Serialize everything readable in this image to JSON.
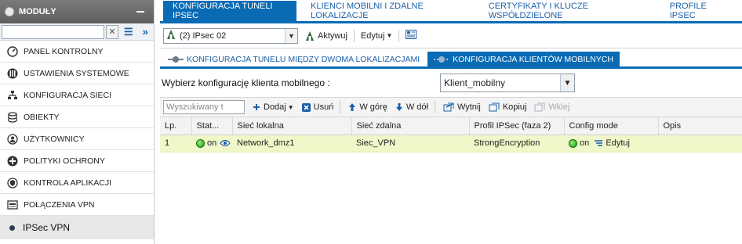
{
  "sidebar": {
    "title": "MODUŁY",
    "search_placeholder": "",
    "items": [
      {
        "label": "PANEL KONTROLNY",
        "icon": "gauge-icon"
      },
      {
        "label": "USTAWIENIA SYSTEMOWE",
        "icon": "sliders-icon"
      },
      {
        "label": "KONFIGURACJA SIECI",
        "icon": "network-icon"
      },
      {
        "label": "OBIEKTY",
        "icon": "database-icon"
      },
      {
        "label": "UŻYTKOWNICY",
        "icon": "user-icon"
      },
      {
        "label": "POLITYKI OCHRONY",
        "icon": "policy-icon"
      },
      {
        "label": "KONTROLA APLIKACJI",
        "icon": "shield-icon"
      },
      {
        "label": "POŁĄCZENIA VPN",
        "icon": "vpn-icon"
      }
    ],
    "active_sub": "IPSec VPN"
  },
  "tabs": [
    {
      "label": "KONFIGURACJA TUNELI IPSEC",
      "active": true
    },
    {
      "label": "KLIENCI MOBILNI I ZDALNE LOKALIZACJE",
      "active": false
    },
    {
      "label": "CERTYFIKATY I KLUCZE WSPÓŁDZIELONE",
      "active": false
    },
    {
      "label": "PROFILE IPSEC",
      "active": false
    }
  ],
  "toolbar1": {
    "policy_value": "(2) IPsec 02",
    "activate_label": "Aktywuj",
    "edit_label": "Edytuj"
  },
  "subtabs": [
    {
      "label": "KONFIGURACJA TUNELU MIĘDZY DWOMA LOKALIZACJAMI",
      "active": false
    },
    {
      "label": "KONFIGURACJA KLIENTÓW MOBILNYCH",
      "active": true
    }
  ],
  "mobile_select": {
    "label": "Wybierz konfigurację klienta mobilnego :",
    "value": "Klient_mobilny"
  },
  "toolbar2": {
    "search_placeholder": "Wyszukiwany t",
    "add_label": "Dodaj",
    "remove_label": "Usuń",
    "up_label": "W górę",
    "down_label": "W dół",
    "cut_label": "Wytnij",
    "copy_label": "Kopiuj",
    "paste_label": "Wklej"
  },
  "grid": {
    "columns": [
      "Lp.",
      "Stat...",
      "Sieć lokalna",
      "Sieć zdalna",
      "Profil IPSec (faza 2)",
      "Config mode",
      "Opis"
    ],
    "rows": [
      {
        "lp": "1",
        "status": "on",
        "local": "Network_dmz1",
        "remote": "Siec_VPN",
        "profile": "StrongEncryption",
        "config_status": "on",
        "config_edit": "Edytuj",
        "desc": ""
      }
    ]
  },
  "colors": {
    "accent": "#0a6bb5",
    "row_highlight": "#f0f7c8",
    "status_on": "#1b9a10"
  }
}
